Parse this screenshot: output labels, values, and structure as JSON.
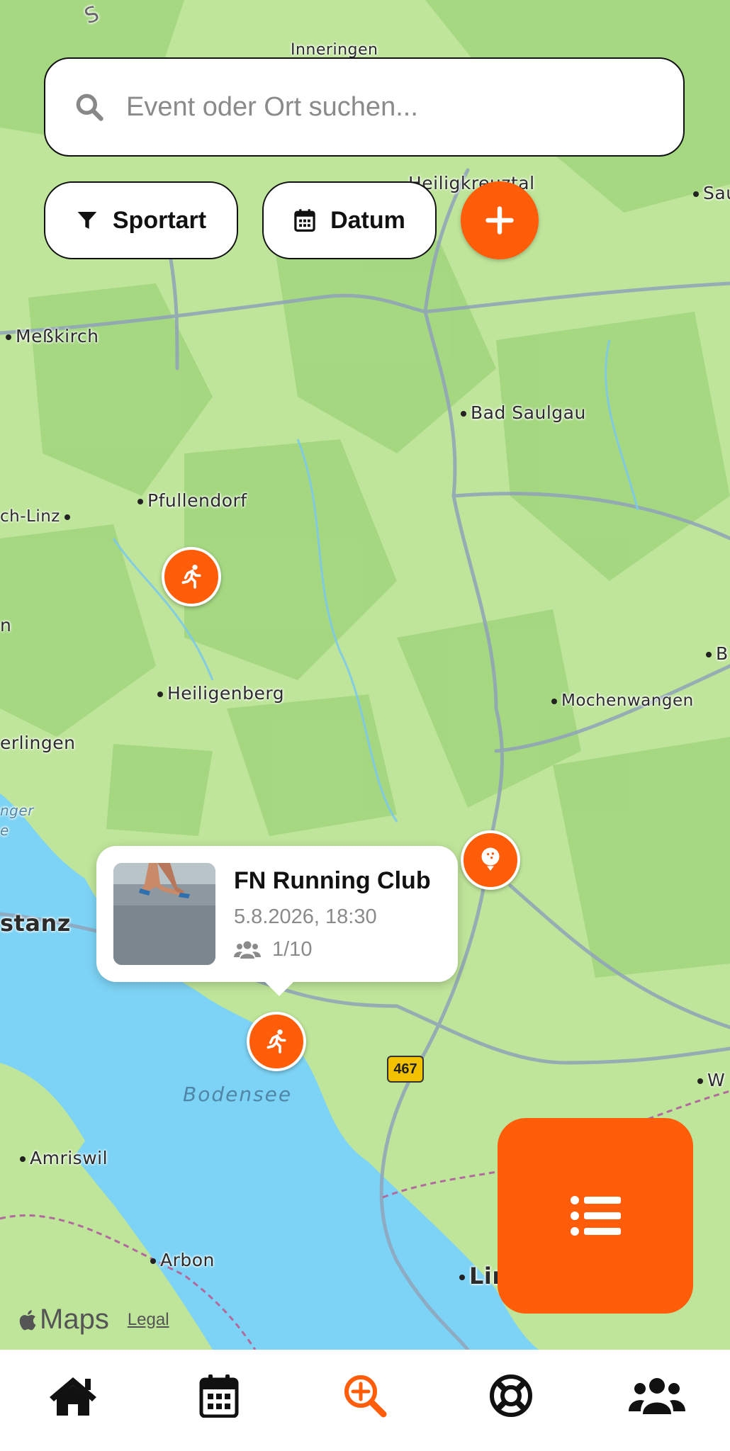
{
  "search": {
    "placeholder": "Event oder Ort suchen..."
  },
  "filters": {
    "sport_label": "Sportart",
    "date_label": "Datum"
  },
  "map": {
    "places": [
      "Inneringen",
      "Heiligkreuztal",
      "Sau",
      "Meßkirch",
      "Bad Saulgau",
      "Pfullendorf",
      "ch-Linz",
      "n",
      "Heiligenberg",
      "Mochenwangen",
      "B",
      "erlingen",
      "nger",
      "e",
      "stanz",
      "W",
      "Amriswil",
      "Arbon",
      "Lin",
      "S"
    ],
    "lake_label": "Bodensee",
    "road_number": "467",
    "attribution": {
      "brand": "Maps",
      "legal": "Legal"
    }
  },
  "event_card": {
    "title": "FN Running Club",
    "datetime": "5.8.2026, 18:30",
    "participants": "1/10"
  },
  "pins": [
    {
      "icon": "running-icon"
    },
    {
      "icon": "golf-icon"
    },
    {
      "icon": "running-icon"
    }
  ],
  "colors": {
    "accent": "#ff5d0a",
    "land": "#bfe59a",
    "forest": "#9dd27a",
    "water": "#7dd3f5"
  },
  "tabbar": {
    "active": "search",
    "items": [
      "home",
      "calendar",
      "search",
      "support",
      "community"
    ]
  }
}
